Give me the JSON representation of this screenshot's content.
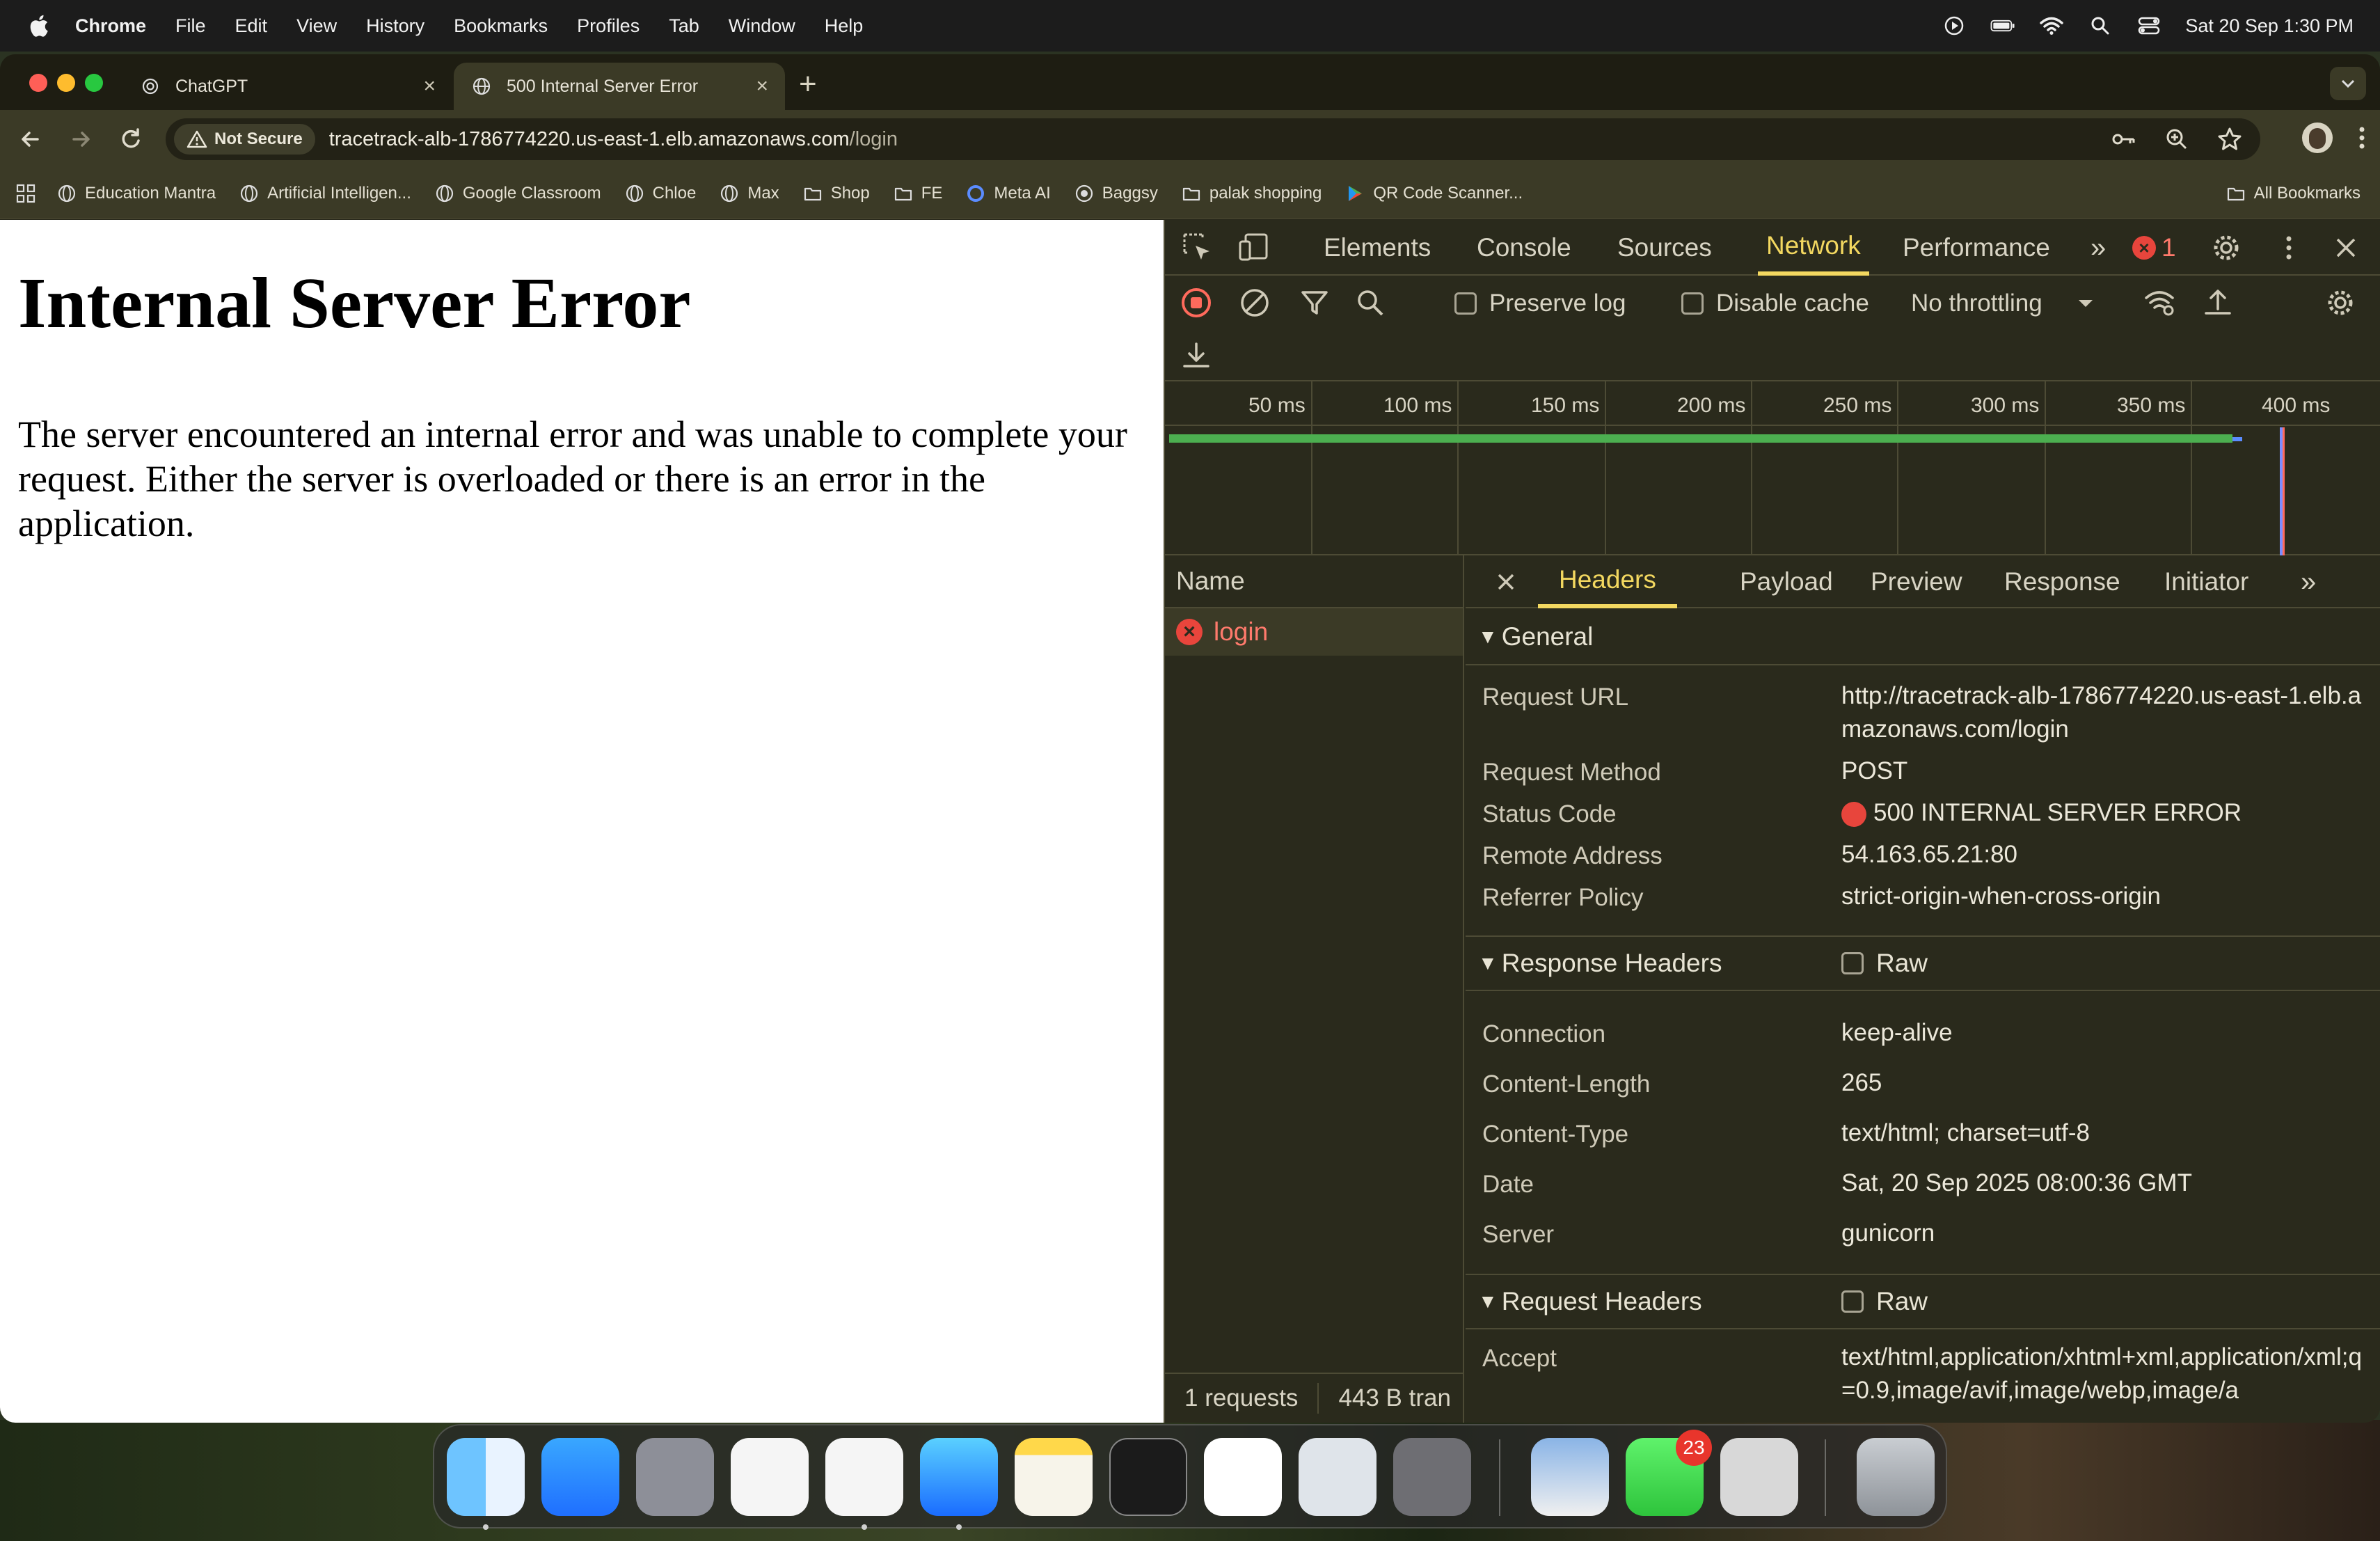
{
  "menubar": {
    "app": "Chrome",
    "items": [
      "File",
      "Edit",
      "View",
      "History",
      "Bookmarks",
      "Profiles",
      "Tab",
      "Window",
      "Help"
    ],
    "datetime": "Sat 20 Sep  1:30 PM"
  },
  "tabs": [
    {
      "title": "ChatGPT"
    },
    {
      "title": "500 Internal Server Error"
    }
  ],
  "omnibox": {
    "security": "Not Secure",
    "url_host": "tracetrack-alb-1786774220.us-east-1.elb.amazonaws.com",
    "url_path": "/login"
  },
  "bookmarks": [
    "Education Mantra",
    "Artificial Intelligen...",
    "Google Classroom",
    "Chloe",
    "Max",
    "Shop",
    "FE",
    "Meta AI",
    "Baggsy",
    "palak shopping",
    "QR Code Scanner..."
  ],
  "all_bookmarks": "All Bookmarks",
  "page": {
    "heading": "Internal Server Error",
    "body": "The server encountered an internal error and was unable to complete your request. Either the server is overloaded or there is an error in the application."
  },
  "devtools": {
    "tabs": [
      "Elements",
      "Console",
      "Sources",
      "Network",
      "Performance"
    ],
    "error_count": "1",
    "toolbar": {
      "preserve_log": "Preserve log",
      "disable_cache": "Disable cache",
      "throttling": "No throttling"
    },
    "timeline_ticks": [
      "50 ms",
      "100 ms",
      "150 ms",
      "200 ms",
      "250 ms",
      "300 ms",
      "350 ms",
      "400 ms"
    ],
    "name_header": "Name",
    "request_name": "login",
    "status_requests": "1 requests",
    "status_transferred": "443 B tran",
    "detail_tabs": [
      "Headers",
      "Payload",
      "Preview",
      "Response",
      "Initiator"
    ],
    "general": {
      "title": "General",
      "rows": [
        {
          "key": "Request URL",
          "value": "http://tracetrack-alb-1786774220.us-east-1.elb.amazonaws.com/login"
        },
        {
          "key": "Request Method",
          "value": "POST"
        },
        {
          "key": "Status Code",
          "value": "500 INTERNAL SERVER ERROR"
        },
        {
          "key": "Remote Address",
          "value": "54.163.65.21:80"
        },
        {
          "key": "Referrer Policy",
          "value": "strict-origin-when-cross-origin"
        }
      ]
    },
    "response_headers": {
      "title": "Response Headers",
      "raw": "Raw",
      "rows": [
        {
          "key": "Connection",
          "value": "keep-alive"
        },
        {
          "key": "Content-Length",
          "value": "265"
        },
        {
          "key": "Content-Type",
          "value": "text/html; charset=utf-8"
        },
        {
          "key": "Date",
          "value": "Sat, 20 Sep 2025 08:00:36 GMT"
        },
        {
          "key": "Server",
          "value": "gunicorn"
        }
      ]
    },
    "request_headers": {
      "title": "Request Headers",
      "raw": "Raw",
      "rows": [
        {
          "key": "Accept",
          "value": "text/html,application/xhtml+xml,application/xml;q=0.9,image/avif,image/webp,image/a"
        }
      ]
    }
  },
  "dock": {
    "facetime_badge": "23"
  },
  "colors": {
    "devtools_bg": "#2a2a1c",
    "accent": "#f3d860",
    "error": "#e8453c"
  }
}
